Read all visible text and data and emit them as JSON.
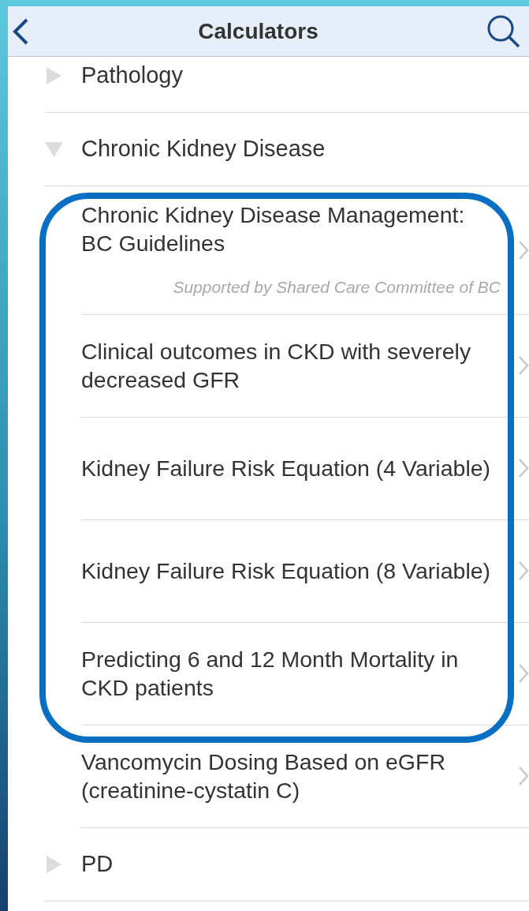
{
  "header": {
    "title": "Calculators"
  },
  "sections": [
    {
      "label": "Pathology",
      "expanded": false
    },
    {
      "label": "Chronic Kidney Disease",
      "expanded": true,
      "items": [
        {
          "title": "Chronic Kidney Disease Management: BC Guidelines",
          "subtitle": "Supported by Shared Care Committee of BC",
          "highlighted": true
        },
        {
          "title": "Clinical outcomes in CKD with severely decreased GFR",
          "highlighted": true
        },
        {
          "title": "Kidney Failure Risk Equation (4 Variable)",
          "highlighted": true
        },
        {
          "title": "Kidney Failure Risk Equation (8 Variable)",
          "highlighted": true
        },
        {
          "title": "Predicting 6 and 12 Month Mortality in CKD patients",
          "highlighted": true
        },
        {
          "title": "Vancomycin Dosing Based on eGFR (creatinine-cystatin C)",
          "highlighted": false
        }
      ]
    },
    {
      "label": "PD",
      "expanded": false
    }
  ]
}
